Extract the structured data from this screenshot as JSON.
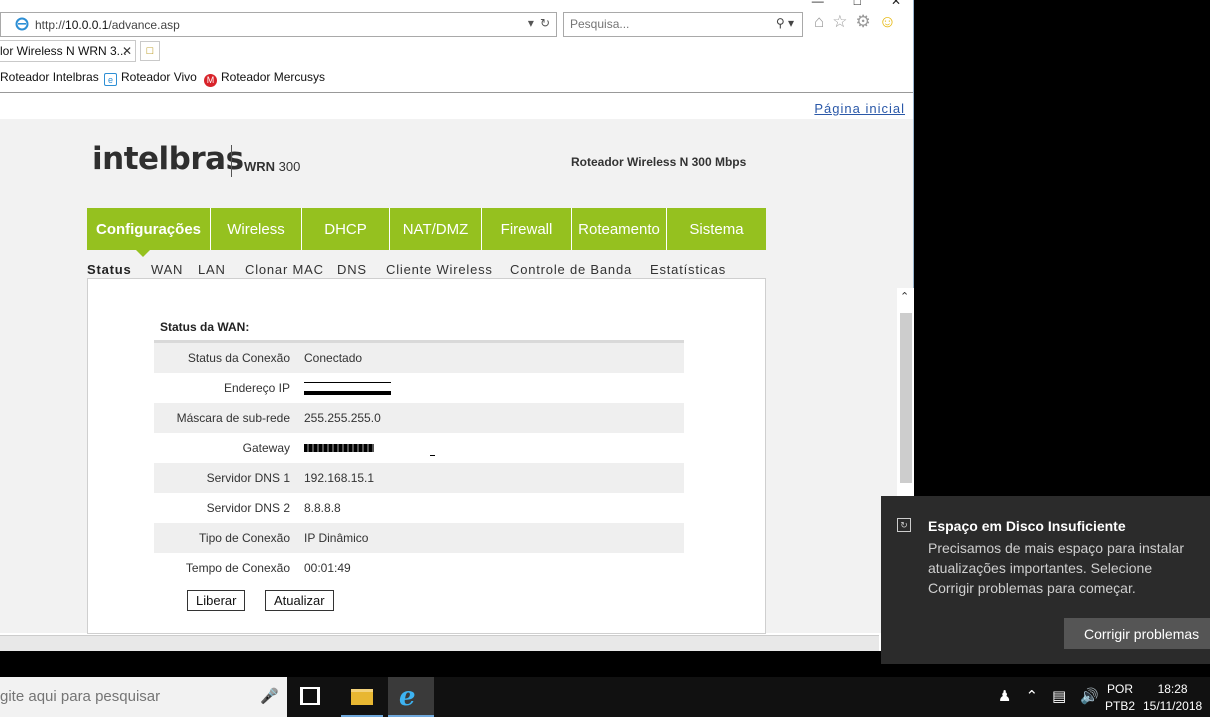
{
  "browser": {
    "url_prefix": "http://",
    "url_host": "10.0.0.1",
    "url_path": "/advance.asp",
    "search_placeholder": "Pesquisa...",
    "tab_title": "lor Wireless N WRN 3...",
    "favorites": [
      {
        "label": "Roteador Intelbras"
      },
      {
        "label": "Roteador Vivo"
      },
      {
        "label": "Roteador Mercusys"
      }
    ]
  },
  "page": {
    "home_link": "Página inicial",
    "logo": "intelbras",
    "model_prefix": "WRN",
    "model_number": "300",
    "product": "Roteador Wireless N 300 Mbps",
    "main_nav": [
      "Configurações",
      "Wireless",
      "DHCP",
      "NAT/DMZ",
      "Firewall",
      "Roteamento",
      "Sistema"
    ],
    "sub_nav": [
      "Status",
      "WAN",
      "LAN",
      "Clonar MAC",
      "DNS",
      "Cliente Wireless",
      "Controle de Banda",
      "Estatísticas"
    ],
    "section_title": "Status da WAN:",
    "rows": [
      {
        "label": "Status da Conexão",
        "value": "Conectado"
      },
      {
        "label": "Endereço IP",
        "value": ""
      },
      {
        "label": "Máscara de sub-rede",
        "value": "255.255.255.0"
      },
      {
        "label": "Gateway",
        "value": ""
      },
      {
        "label": "Servidor DNS 1",
        "value": "192.168.15.1"
      },
      {
        "label": "Servidor DNS 2",
        "value": "8.8.8.8"
      },
      {
        "label": "Tipo de Conexão",
        "value": "IP Dinâmico"
      },
      {
        "label": "Tempo de Conexão",
        "value": "00:01:49"
      }
    ],
    "buttons": {
      "release": "Liberar",
      "refresh": "Atualizar"
    }
  },
  "toast": {
    "title": "Espaço em Disco Insuficiente",
    "message": "Precisamos de mais espaço para instalar atualizações importantes. Selecione Corrigir problemas para começar.",
    "action": "Corrigir problemas"
  },
  "taskbar": {
    "search_placeholder": "gite aqui para pesquisar",
    "lang_1": "POR",
    "lang_2": "PTB2",
    "time": "18:28",
    "date": "15/11/2018"
  },
  "colors": {
    "accent_green": "#95c11f",
    "link_blue": "#2a58a8",
    "toast_bg": "#2b2b2b"
  }
}
